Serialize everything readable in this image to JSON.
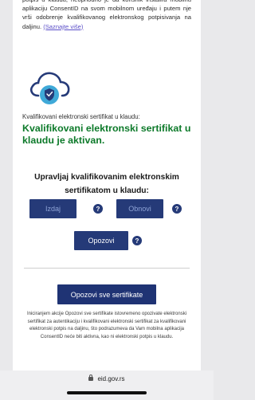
{
  "intro": {
    "text": "potpis u klaudu, neophodno je da korisnik instalira mobilnu aplikaciju ConsentID na svom mobilnom uređaju i putem nje vrši odobrenje kvalifikovanog elektronskog potpisivanja na daljinu.",
    "link": "(Saznajte više)"
  },
  "cloud_icon": "cloud-shield-icon",
  "cert_label": "Kvalifikovani elektronski sertifikat u klaudu:",
  "status": "Kvalifikovani elektronski sertifikat u klaudu je aktivan.",
  "manage_heading": "Upravljaj kvalifikovanim elektronskim sertifikatom u klaudu:",
  "buttons": {
    "issue": "Izdaj",
    "renew": "Obnovi",
    "revoke": "Opozovi",
    "help": "?",
    "revoke_all": "Opozovi sve sertifikate"
  },
  "info_text": "Iniciranjem akcije Opozovi sve sertifikate istovremeno opozivate elektronski sertifikat za autentikaciju i kvalifikovani elektronski sertifikat za kvalifikovani elektronski potpis na daljinu, što podrazumeva da Vam mobilna aplikacija ConsentID neće biti aktivna, kao ni elektronski potpis u klaudu.",
  "browser": {
    "url": "eid.gov.rs"
  },
  "colors": {
    "primary": "#253a78",
    "success": "#0d7a2a",
    "link": "#5b4fc8"
  }
}
